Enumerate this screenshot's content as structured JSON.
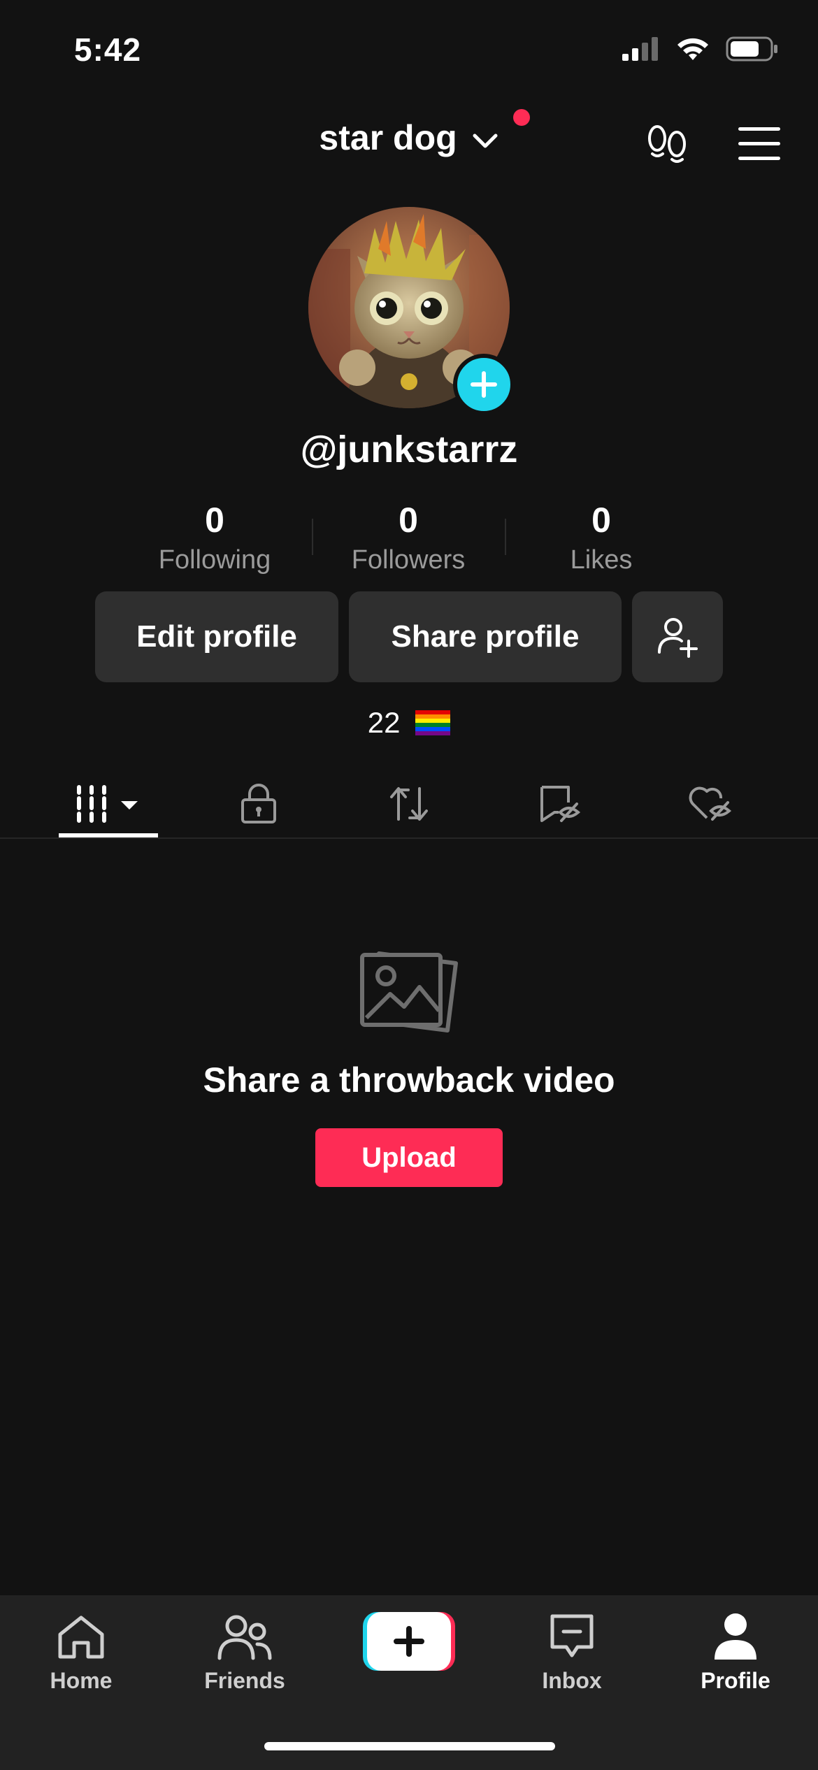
{
  "status_bar": {
    "time": "5:42"
  },
  "header": {
    "account_name": "star dog"
  },
  "profile": {
    "username": "@junkstarrz",
    "bio_text": "22"
  },
  "stats": [
    {
      "value": "0",
      "label": "Following"
    },
    {
      "value": "0",
      "label": "Followers"
    },
    {
      "value": "0",
      "label": "Likes"
    }
  ],
  "actions": {
    "edit_profile": "Edit profile",
    "share_profile": "Share profile"
  },
  "empty_state": {
    "title": "Share a throwback video",
    "upload_label": "Upload"
  },
  "bottom_nav": [
    {
      "label": "Home",
      "icon": "home-icon"
    },
    {
      "label": "Friends",
      "icon": "friends-icon"
    },
    {
      "label": "",
      "icon": "create-icon"
    },
    {
      "label": "Inbox",
      "icon": "inbox-icon"
    },
    {
      "label": "Profile",
      "icon": "profile-icon"
    }
  ],
  "colors": {
    "background": "#121212",
    "accent_red": "#fe2c55",
    "accent_cyan": "#20d5ec",
    "button_bg": "#2f2f2f"
  }
}
